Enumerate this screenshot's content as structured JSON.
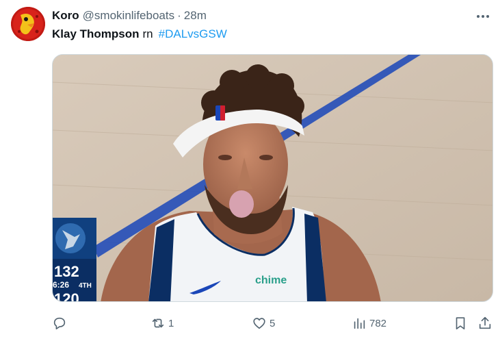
{
  "author": {
    "name": "Koro",
    "handle": "@smokinlifeboats",
    "separator": "·",
    "time": "28m"
  },
  "tweet": {
    "text_bold": "Klay Thompson",
    "text_plain": "rn",
    "hashtag": "#DALvsGSW"
  },
  "media": {
    "jersey_text": "chime",
    "scoreboard": {
      "score_top": "132",
      "clock": "6:26",
      "quarter": "4TH",
      "score_bottom": "120"
    }
  },
  "actions": {
    "replies": "",
    "retweets": "1",
    "likes": "5",
    "views": "782"
  },
  "colors": {
    "hashtag": "#1d9bf0",
    "muted": "#536471",
    "court_line": "#1a46b8",
    "mavs_navy": "#0b2e63"
  }
}
